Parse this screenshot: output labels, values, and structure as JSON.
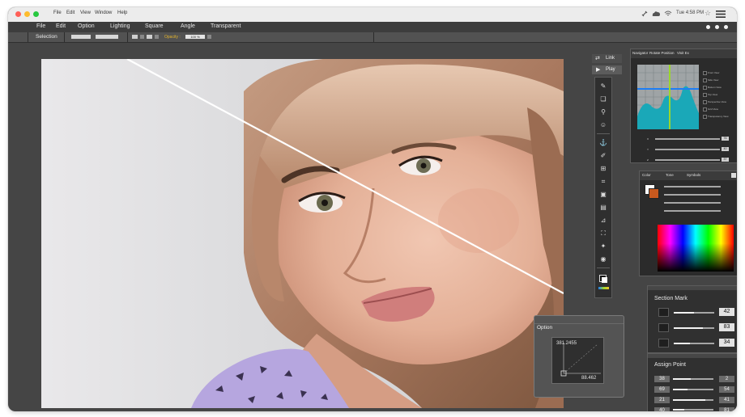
{
  "macbar": {
    "menus": [
      "File",
      "Edit",
      "View",
      "Window",
      "Help"
    ],
    "clock": "Tue 4:58 PM"
  },
  "app_menu": [
    "File",
    "Edit",
    "Option",
    "Lighting",
    "Square",
    "Angle",
    "Transparent"
  ],
  "options_bar": {
    "selection_label": "Selection",
    "opacity_label": "Opacity :",
    "opacity_value": "100 %"
  },
  "toolbar": {
    "link_label": "Link",
    "play_label": "Play"
  },
  "navigator": {
    "tabs": [
      "Navigator",
      "Rotate Position",
      "Visit Ex"
    ],
    "views": [
      "Front View",
      "Side View",
      "Bottom View",
      "Top View",
      "Perspective View",
      "Grid View",
      "Transparency View"
    ],
    "axes": [
      "X",
      "Y",
      "Z"
    ],
    "axis_values": [
      "76",
      "40",
      "37"
    ]
  },
  "color_panel": {
    "tabs": [
      "Color",
      "Tone",
      "Symbols"
    ]
  },
  "section_mark": {
    "title": "Section Mark",
    "values": [
      "42",
      "83",
      "34"
    ],
    "levels": [
      0.5,
      0.72,
      0.4
    ]
  },
  "assign_point": {
    "title": "Assign Point",
    "rows": [
      {
        "left": "38",
        "right": "2"
      },
      {
        "left": "69",
        "right": "54"
      },
      {
        "left": "21",
        "right": "41"
      },
      {
        "left": "40",
        "right": "81"
      }
    ]
  },
  "option_popup": {
    "title": "Option",
    "readout_top": "381.2455",
    "readout_bottom": "88.462"
  },
  "colors": {
    "accent_green": "#9bd62c",
    "accent_blue": "#1d7ef5",
    "teal_chart": "#1aa8b8"
  }
}
